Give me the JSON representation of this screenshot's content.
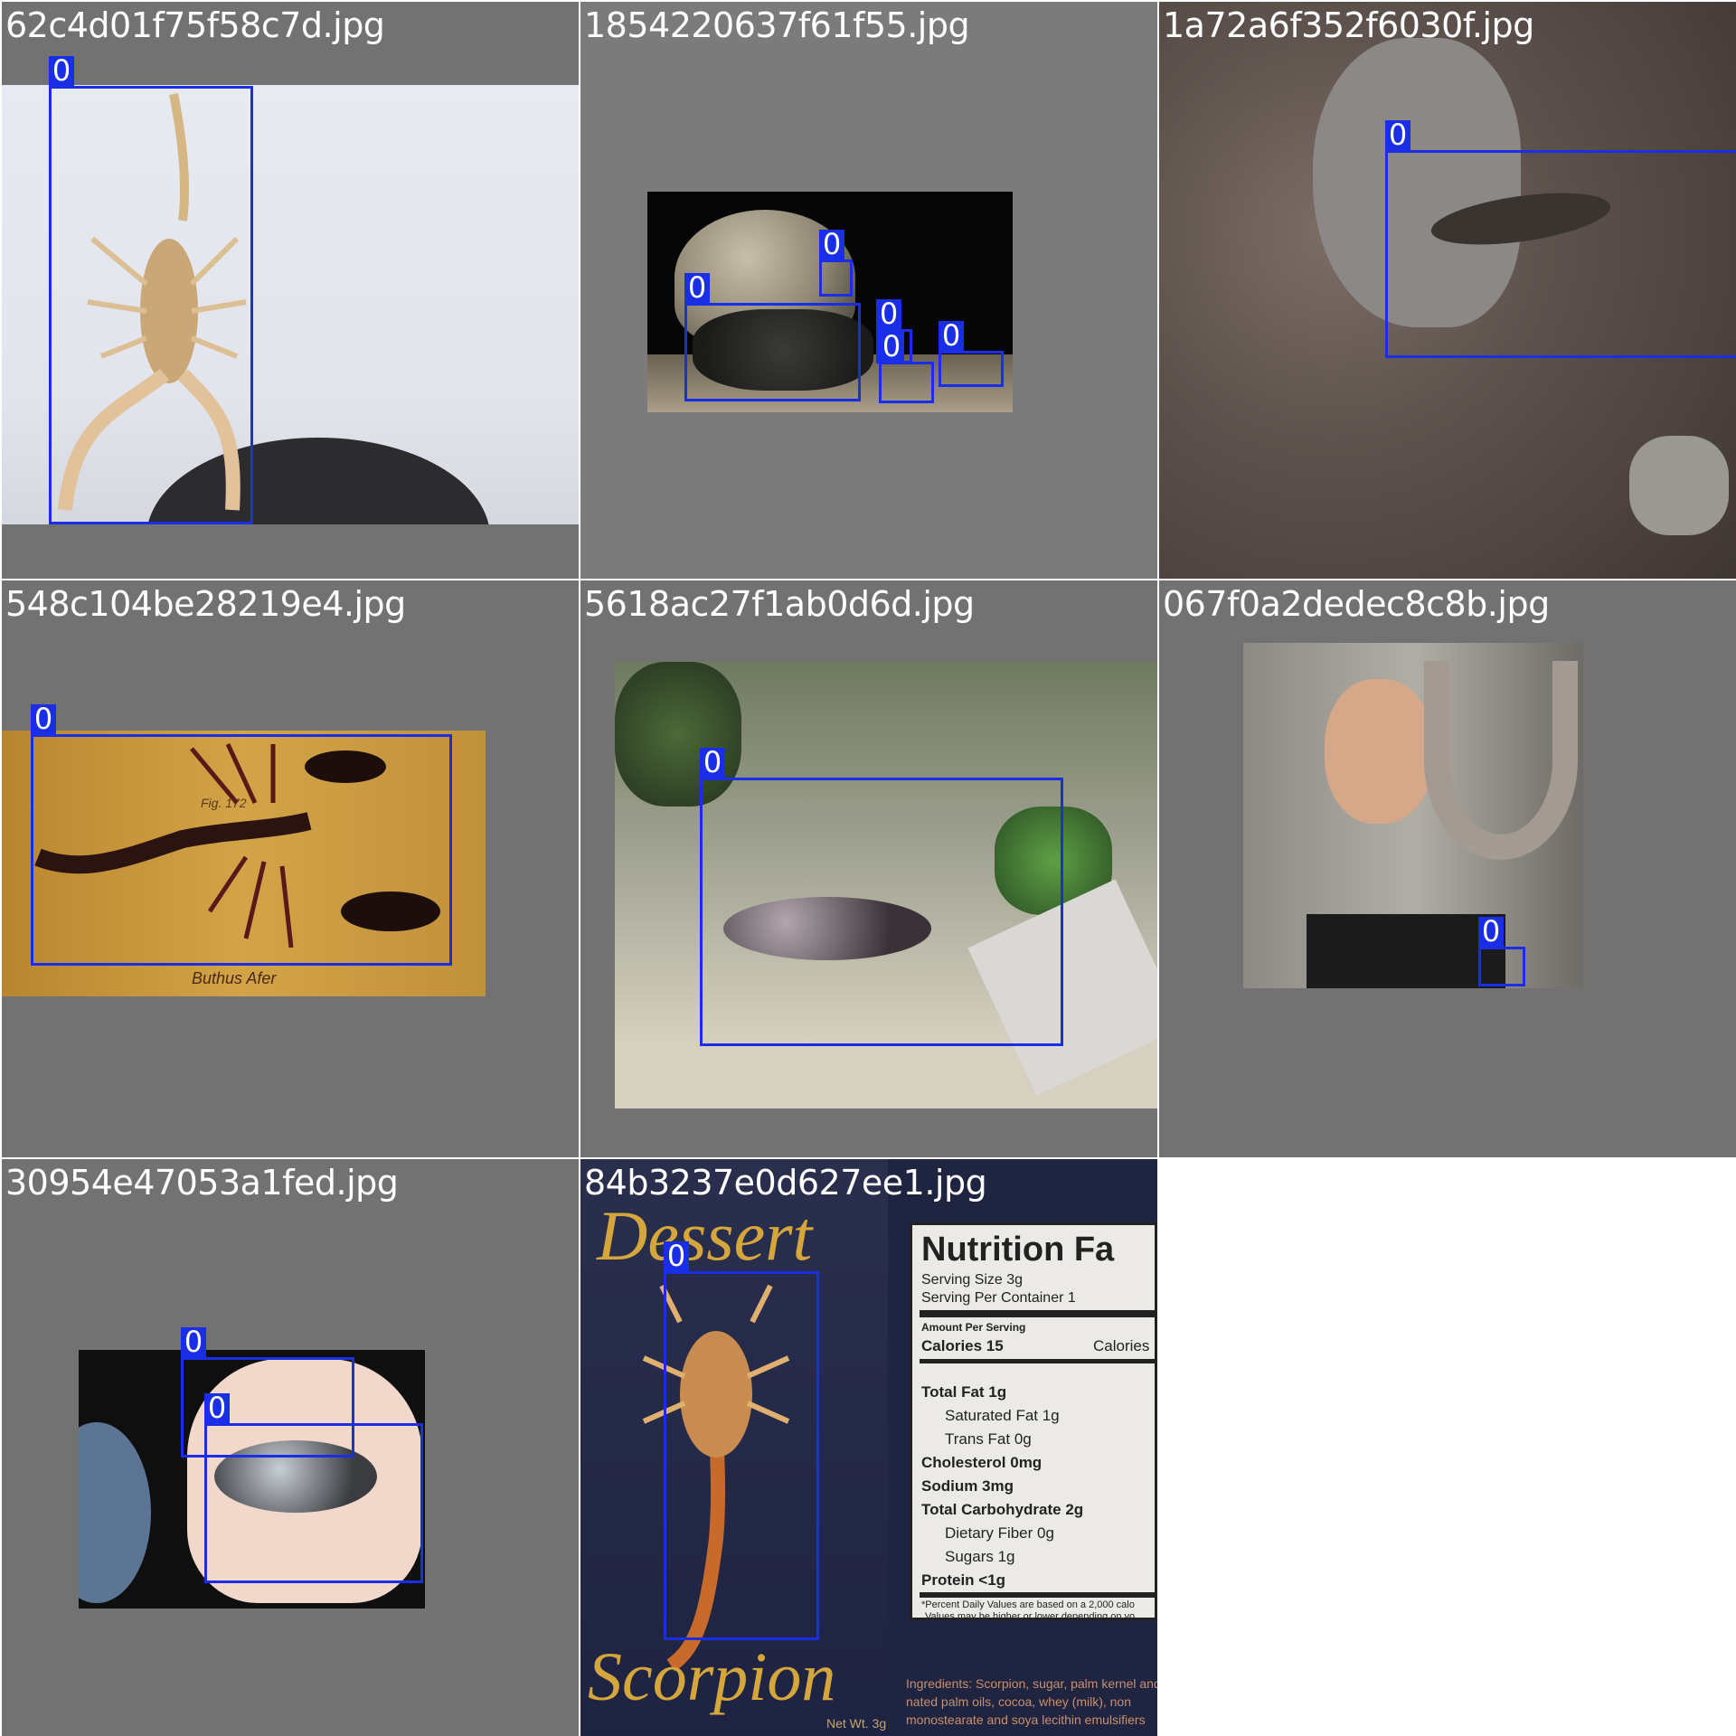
{
  "grid": {
    "tiles": [
      {
        "filename": "62c4d01f75f58c7d.jpg",
        "labels": [
          "0"
        ]
      },
      {
        "filename": "1854220637f61f55.jpg",
        "labels": [
          "0",
          "0",
          "0",
          "0",
          "0"
        ]
      },
      {
        "filename": "1a72a6f352f6030f.jpg",
        "labels": [
          "0"
        ]
      },
      {
        "filename": "548c104be28219e4.jpg",
        "labels": [
          "0"
        ]
      },
      {
        "filename": "5618ac27f1ab0d6d.jpg",
        "labels": [
          "0"
        ]
      },
      {
        "filename": "067f0a2dedec8c8b.jpg",
        "labels": [
          "0"
        ]
      },
      {
        "filename": "30954e47053a1fed.jpg",
        "labels": [
          "0",
          "0"
        ]
      },
      {
        "filename": "84b3237e0d627ee1.jpg",
        "labels": [
          "0"
        ]
      }
    ]
  },
  "illustration": {
    "caption": "Buthus Afer",
    "fig_note": "Fig. 172"
  },
  "package": {
    "title_top": "Dessert",
    "title_bottom": "Scorpion",
    "net_weight": "Net Wt. 3g"
  },
  "nutrition": {
    "heading": "Nutrition Fa",
    "serving_size": "Serving Size 3g",
    "servings_per_container": "Serving Per Container 1",
    "amount_per_serving": "Amount Per Serving",
    "calories": "Calories 15",
    "calories_from_fat": "Calories",
    "rows": [
      "Total Fat 1g",
      "Saturated Fat 1g",
      "Trans Fat 0g",
      "Cholesterol 0mg",
      "Sodium 3mg",
      "Total Carbohydrate 2g",
      "Dietary Fiber 0g",
      "Sugars 1g",
      "Protein <1g"
    ],
    "footnote_1": "*Percent Daily Values are based on a 2,000 calo",
    "footnote_2": "Values may be higher or lower depending on yo",
    "ingredients_1": "Ingredients: Scorpion, sugar, palm kernel and",
    "ingredients_2": "nated palm oils, cocoa, whey (milk), non",
    "ingredients_3": "monostearate and soya lecithin emulsifiers"
  },
  "colors": {
    "bbox": "#1a2ee6",
    "background": "#727272",
    "label_text": "#ffffff"
  }
}
